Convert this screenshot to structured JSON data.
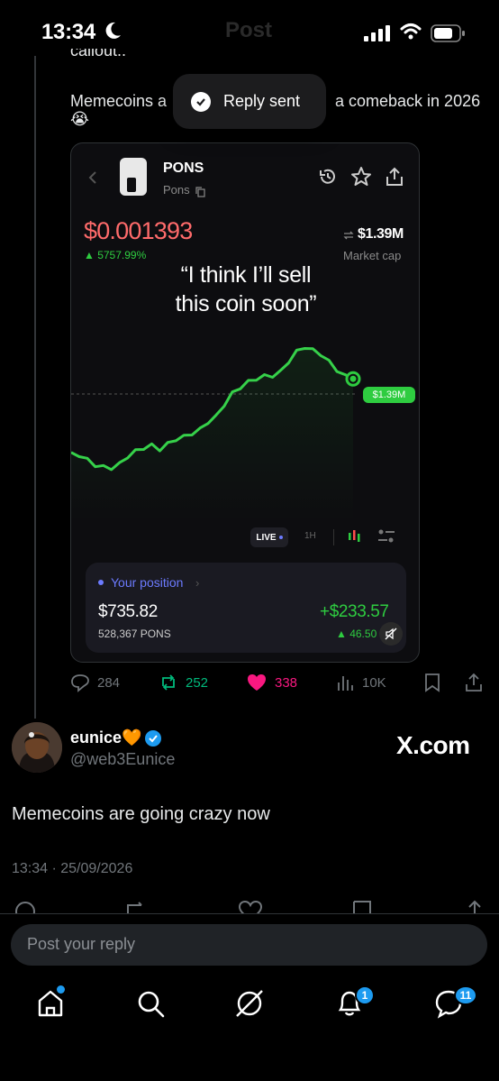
{
  "status_bar": {
    "time": "13:34",
    "background_title": "Post"
  },
  "thread": {
    "clipped_line": "callout..",
    "text_start": "Memecoins a",
    "text_end": "a comeback in 2026",
    "emoji": "😭"
  },
  "toast": {
    "label": "Reply sent"
  },
  "card": {
    "token_name": "PONS",
    "token_sub": "Pons",
    "price": "$0.001393",
    "change": "▲ 5757.99%",
    "market_cap_value": "$1.39M",
    "market_cap_label": "Market cap",
    "overlay_caption_line1": "“I think I’ll sell",
    "overlay_caption_line2": "this coin soon”",
    "current_value_tag": "$1.39M",
    "timeframes": {
      "live": "LIVE",
      "h1": "1H"
    },
    "position": {
      "label": "Your position",
      "value": "$735.82",
      "amount": "528,367 PONS",
      "pnl": "+$233.57",
      "pnl_pct": "▲ 46.50"
    },
    "colors": {
      "price": "#ff6b6b",
      "up": "#2ecc40",
      "accent": "#6c7bff"
    }
  },
  "chart_data": {
    "type": "line",
    "title": "",
    "xlabel": "",
    "ylabel": "",
    "series": [
      {
        "values": [
          0.17,
          0.15,
          0.12,
          0.08,
          0.07,
          0.06,
          0.09,
          0.14,
          0.18,
          0.2,
          0.22,
          0.19,
          0.23,
          0.26,
          0.28,
          0.3,
          0.33,
          0.38,
          0.42,
          0.5,
          0.58,
          0.62,
          0.66,
          0.68,
          0.7,
          0.7,
          0.73,
          0.8,
          0.87,
          0.9,
          0.88,
          0.85,
          0.8,
          0.74,
          0.7,
          0.68
        ]
      }
    ]
  },
  "actions": {
    "replies": "284",
    "reposts": "252",
    "likes": "338",
    "views": "10K"
  },
  "author": {
    "name": "eunice🧡",
    "handle": "@web3Eunice",
    "watermark": "X.com"
  },
  "post": {
    "text": "Memecoins are going crazy now",
    "timestamp": "13:34 · 25/09/2026"
  },
  "reply": {
    "placeholder": "Post your reply"
  },
  "tabbar": {
    "notifications_badge": "1",
    "messages_badge": "11"
  }
}
